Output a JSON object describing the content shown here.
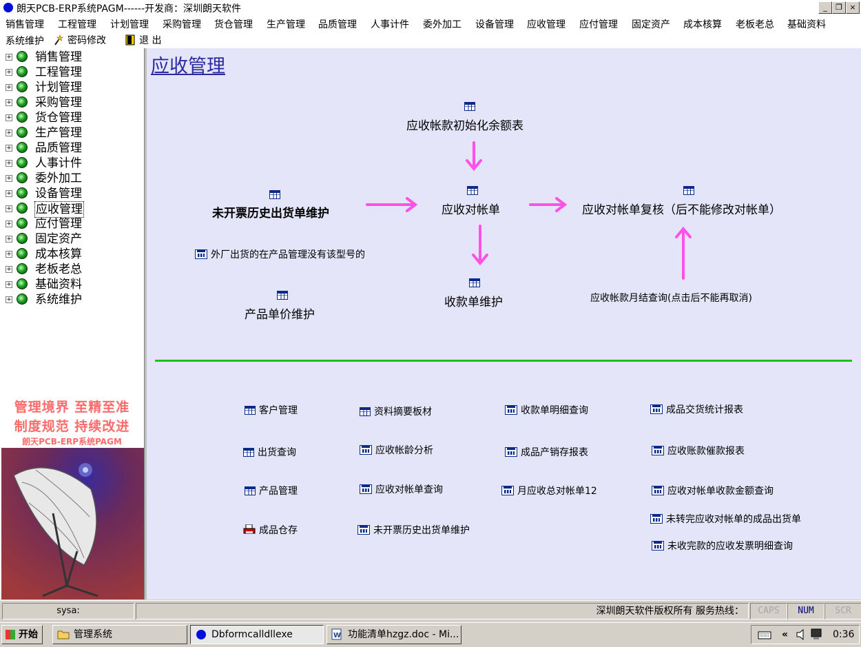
{
  "window": {
    "title": "朗天PCB-ERP系统PAGM------开发商：深圳朗天软件",
    "minimize_glyph": "_",
    "restore_glyph": "❐",
    "close_glyph": "×"
  },
  "menubar": {
    "row1": [
      "销售管理",
      "工程管理",
      "计划管理",
      "采购管理",
      "货仓管理",
      "生产管理",
      "品质管理",
      "人事计件",
      "委外加工",
      "设备管理",
      "应收管理",
      "应付管理",
      "固定资产",
      "成本核算",
      "老板老总",
      "基础资料"
    ],
    "row2": {
      "system": "系统维护",
      "password": "密码修改",
      "exit": "退 出"
    }
  },
  "sidebar": {
    "items": [
      "销售管理",
      "工程管理",
      "计划管理",
      "采购管理",
      "货仓管理",
      "生产管理",
      "品质管理",
      "人事计件",
      "委外加工",
      "设备管理",
      "应收管理",
      "应付管理",
      "固定资产",
      "成本核算",
      "老板老总",
      "基础资料",
      "系统维护"
    ],
    "selected": "应收管理",
    "expander": "+",
    "slogan_line1": "管理境界  至精至准",
    "slogan_line2": "制度规范  持续改进",
    "brand": "朗天PCB-ERP系统PAGM"
  },
  "main": {
    "title": "应收管理",
    "flow": {
      "initial_balance": "应收帐款初始化余额表",
      "unbilled_history": "未开票历史出货单维护",
      "reconciliation": "应收对帐单",
      "reconciliation_review": "应收对帐单复核（后不能修改对帐单）",
      "outsourced_shipment": "外厂出货的在产品管理没有该型号的",
      "product_price": "产品单价维护",
      "receipt_maintenance": "收款单维护",
      "monthly_close_query": "应收帐款月结查询(点击后不能再取消)"
    },
    "links": {
      "col1": [
        "客户管理",
        "出货查询",
        "产品管理",
        "成品仓存"
      ],
      "col2": [
        "资料摘要板材",
        "应收帐龄分析",
        "应收对帐单查询",
        "未开票历史出货单维护"
      ],
      "col3": [
        "收款单明细查询",
        "成品产销存报表",
        "月应收总对帐单12"
      ],
      "col4": [
        "成品交货统计报表",
        "应收账款催款报表",
        "应收对帐单收款金额查询",
        "未转完应收对帐单的成品出货单",
        "未收完款的应收发票明细查询"
      ]
    },
    "colors": {
      "arrow": "#ff50e8",
      "divider": "#19c419",
      "background": "#e5e5f9"
    }
  },
  "statusbar": {
    "user": "sysa:",
    "copyright": "深圳朗天软件版权所有   服务热线：",
    "caps": "CAPS",
    "num": "NUM",
    "scr": "SCR"
  },
  "taskbar": {
    "start": "开始",
    "tasks": [
      "管理系统",
      "Dbformcalldllexe",
      "功能清单hzgz.doc - Mi..."
    ],
    "clock": "0:36",
    "tray_chevron": "«"
  },
  "icons": {
    "titlebar": "app-dot-icon",
    "wizard": "wizard-icon",
    "exit": "door-exit-icon",
    "tree_node": "globe-green-icon",
    "flow_node": "grid-table-icon",
    "report": "report-chart-icon",
    "printer": "printer-icon"
  }
}
